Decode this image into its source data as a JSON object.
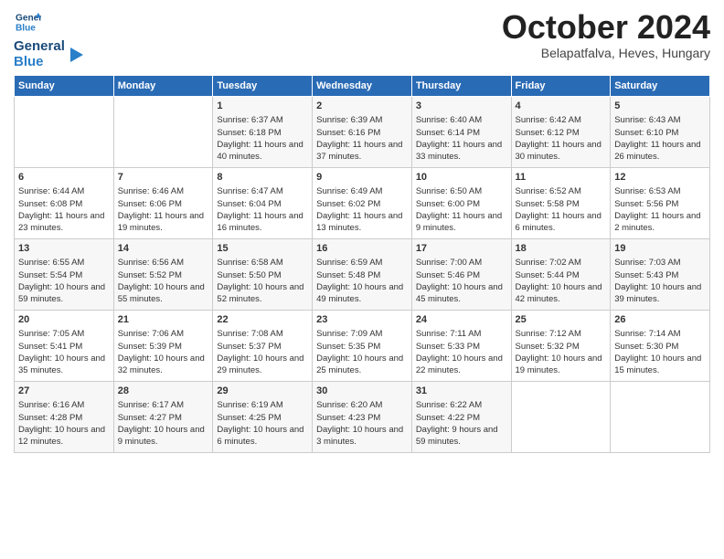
{
  "header": {
    "logo_line1": "General",
    "logo_line2": "Blue",
    "month": "October 2024",
    "location": "Belapatfalva, Heves, Hungary"
  },
  "days_of_week": [
    "Sunday",
    "Monday",
    "Tuesday",
    "Wednesday",
    "Thursday",
    "Friday",
    "Saturday"
  ],
  "weeks": [
    [
      {
        "day": "",
        "info": ""
      },
      {
        "day": "",
        "info": ""
      },
      {
        "day": "1",
        "info": "Sunrise: 6:37 AM\nSunset: 6:18 PM\nDaylight: 11 hours and 40 minutes."
      },
      {
        "day": "2",
        "info": "Sunrise: 6:39 AM\nSunset: 6:16 PM\nDaylight: 11 hours and 37 minutes."
      },
      {
        "day": "3",
        "info": "Sunrise: 6:40 AM\nSunset: 6:14 PM\nDaylight: 11 hours and 33 minutes."
      },
      {
        "day": "4",
        "info": "Sunrise: 6:42 AM\nSunset: 6:12 PM\nDaylight: 11 hours and 30 minutes."
      },
      {
        "day": "5",
        "info": "Sunrise: 6:43 AM\nSunset: 6:10 PM\nDaylight: 11 hours and 26 minutes."
      }
    ],
    [
      {
        "day": "6",
        "info": "Sunrise: 6:44 AM\nSunset: 6:08 PM\nDaylight: 11 hours and 23 minutes."
      },
      {
        "day": "7",
        "info": "Sunrise: 6:46 AM\nSunset: 6:06 PM\nDaylight: 11 hours and 19 minutes."
      },
      {
        "day": "8",
        "info": "Sunrise: 6:47 AM\nSunset: 6:04 PM\nDaylight: 11 hours and 16 minutes."
      },
      {
        "day": "9",
        "info": "Sunrise: 6:49 AM\nSunset: 6:02 PM\nDaylight: 11 hours and 13 minutes."
      },
      {
        "day": "10",
        "info": "Sunrise: 6:50 AM\nSunset: 6:00 PM\nDaylight: 11 hours and 9 minutes."
      },
      {
        "day": "11",
        "info": "Sunrise: 6:52 AM\nSunset: 5:58 PM\nDaylight: 11 hours and 6 minutes."
      },
      {
        "day": "12",
        "info": "Sunrise: 6:53 AM\nSunset: 5:56 PM\nDaylight: 11 hours and 2 minutes."
      }
    ],
    [
      {
        "day": "13",
        "info": "Sunrise: 6:55 AM\nSunset: 5:54 PM\nDaylight: 10 hours and 59 minutes."
      },
      {
        "day": "14",
        "info": "Sunrise: 6:56 AM\nSunset: 5:52 PM\nDaylight: 10 hours and 55 minutes."
      },
      {
        "day": "15",
        "info": "Sunrise: 6:58 AM\nSunset: 5:50 PM\nDaylight: 10 hours and 52 minutes."
      },
      {
        "day": "16",
        "info": "Sunrise: 6:59 AM\nSunset: 5:48 PM\nDaylight: 10 hours and 49 minutes."
      },
      {
        "day": "17",
        "info": "Sunrise: 7:00 AM\nSunset: 5:46 PM\nDaylight: 10 hours and 45 minutes."
      },
      {
        "day": "18",
        "info": "Sunrise: 7:02 AM\nSunset: 5:44 PM\nDaylight: 10 hours and 42 minutes."
      },
      {
        "day": "19",
        "info": "Sunrise: 7:03 AM\nSunset: 5:43 PM\nDaylight: 10 hours and 39 minutes."
      }
    ],
    [
      {
        "day": "20",
        "info": "Sunrise: 7:05 AM\nSunset: 5:41 PM\nDaylight: 10 hours and 35 minutes."
      },
      {
        "day": "21",
        "info": "Sunrise: 7:06 AM\nSunset: 5:39 PM\nDaylight: 10 hours and 32 minutes."
      },
      {
        "day": "22",
        "info": "Sunrise: 7:08 AM\nSunset: 5:37 PM\nDaylight: 10 hours and 29 minutes."
      },
      {
        "day": "23",
        "info": "Sunrise: 7:09 AM\nSunset: 5:35 PM\nDaylight: 10 hours and 25 minutes."
      },
      {
        "day": "24",
        "info": "Sunrise: 7:11 AM\nSunset: 5:33 PM\nDaylight: 10 hours and 22 minutes."
      },
      {
        "day": "25",
        "info": "Sunrise: 7:12 AM\nSunset: 5:32 PM\nDaylight: 10 hours and 19 minutes."
      },
      {
        "day": "26",
        "info": "Sunrise: 7:14 AM\nSunset: 5:30 PM\nDaylight: 10 hours and 15 minutes."
      }
    ],
    [
      {
        "day": "27",
        "info": "Sunrise: 6:16 AM\nSunset: 4:28 PM\nDaylight: 10 hours and 12 minutes."
      },
      {
        "day": "28",
        "info": "Sunrise: 6:17 AM\nSunset: 4:27 PM\nDaylight: 10 hours and 9 minutes."
      },
      {
        "day": "29",
        "info": "Sunrise: 6:19 AM\nSunset: 4:25 PM\nDaylight: 10 hours and 6 minutes."
      },
      {
        "day": "30",
        "info": "Sunrise: 6:20 AM\nSunset: 4:23 PM\nDaylight: 10 hours and 3 minutes."
      },
      {
        "day": "31",
        "info": "Sunrise: 6:22 AM\nSunset: 4:22 PM\nDaylight: 9 hours and 59 minutes."
      },
      {
        "day": "",
        "info": ""
      },
      {
        "day": "",
        "info": ""
      }
    ]
  ]
}
